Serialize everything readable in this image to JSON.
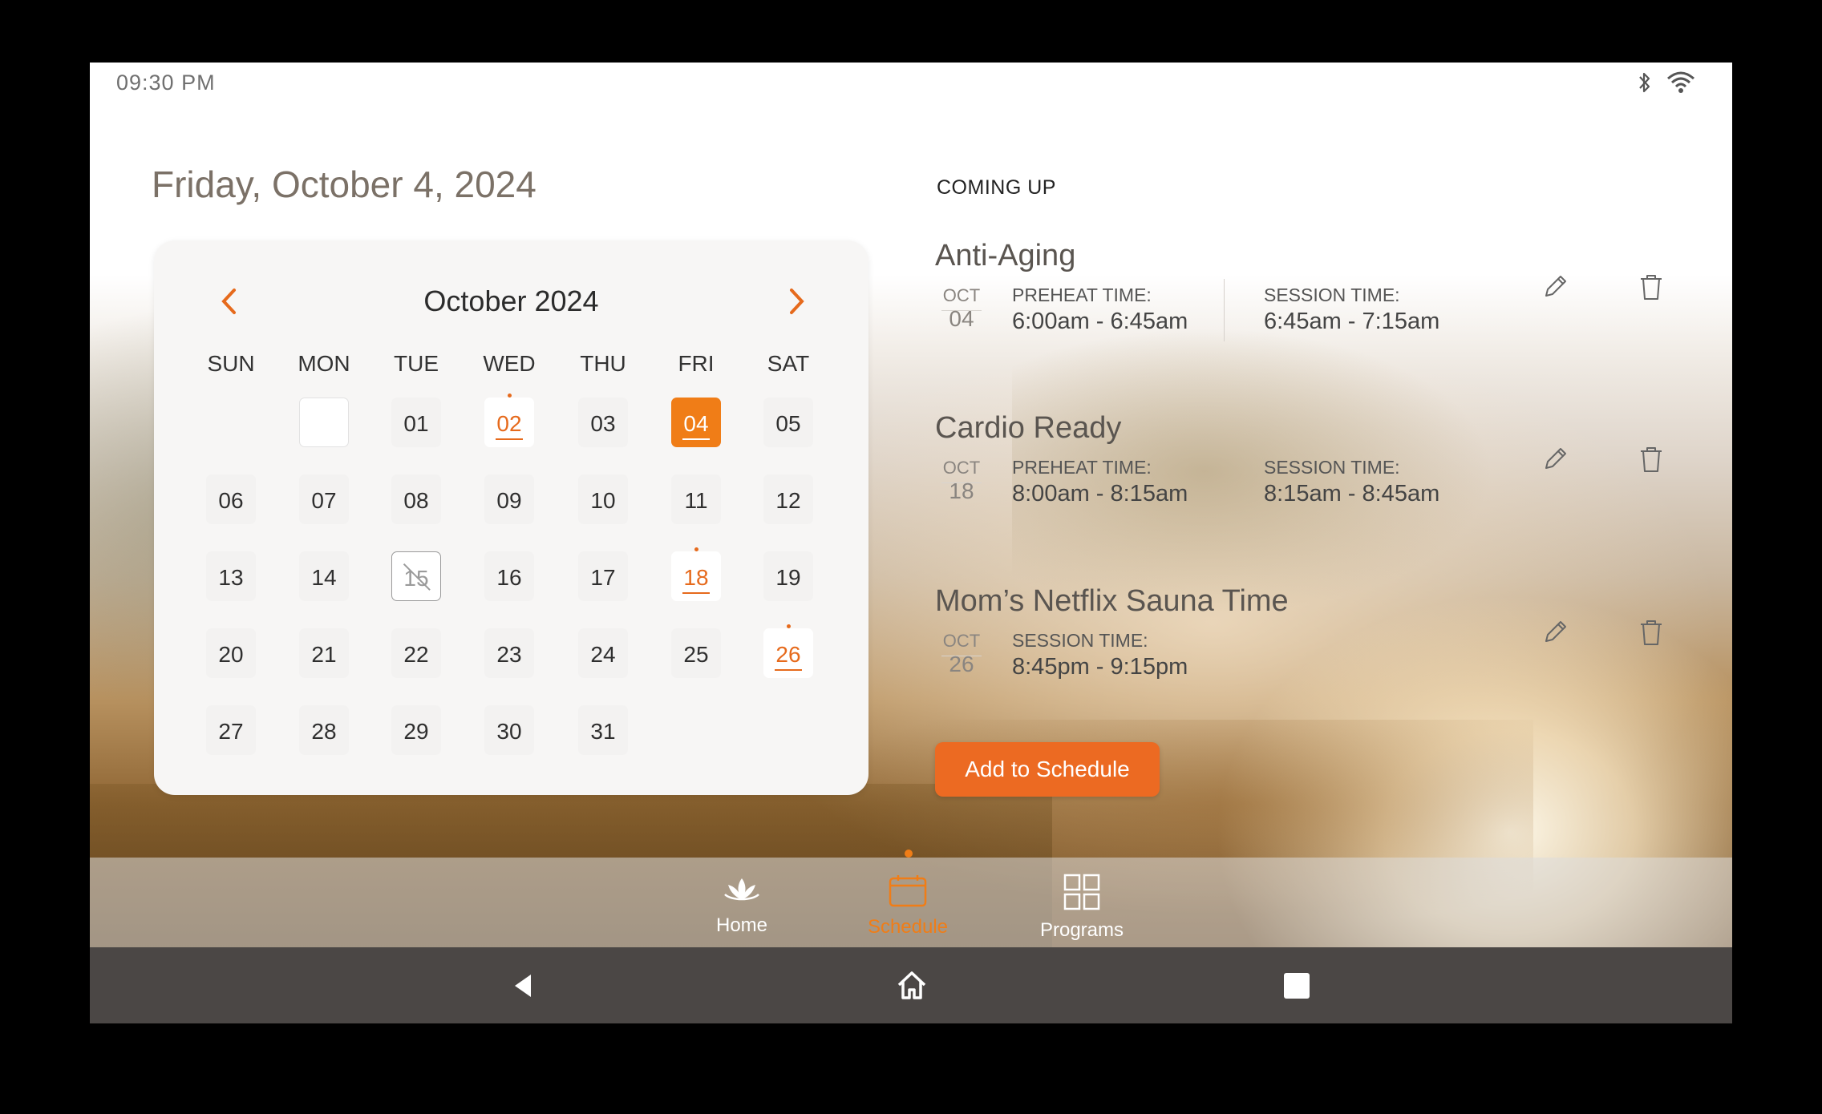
{
  "status": {
    "time": "09:30 PM",
    "icons": [
      "bluetooth-icon",
      "wifi-icon"
    ]
  },
  "header": {
    "date": "Friday, October 4, 2024"
  },
  "calendar": {
    "month_label": "October 2024",
    "weekdays": [
      "SUN",
      "MON",
      "TUE",
      "WED",
      "THU",
      "FRI",
      "SAT"
    ],
    "days": [
      "01",
      "02",
      "03",
      "04",
      "05",
      "06",
      "07",
      "08",
      "09",
      "10",
      "11",
      "12",
      "13",
      "14",
      "15",
      "16",
      "17",
      "18",
      "19",
      "20",
      "21",
      "22",
      "23",
      "24",
      "25",
      "26",
      "27",
      "28",
      "29",
      "30",
      "31"
    ],
    "first_weekday_index": 2,
    "selected_day": "04",
    "event_days": [
      "02",
      "18",
      "26"
    ],
    "disabled_days": [
      "15"
    ]
  },
  "upcoming": {
    "heading": "COMING UP",
    "items": [
      {
        "name": "Anti-Aging",
        "month": "OCT",
        "day": "04",
        "label1": "PREHEAT TIME:",
        "value1": "6:00am - 6:45am",
        "label2": "SESSION TIME:",
        "value2": "6:45am - 7:15am"
      },
      {
        "name": "Cardio Ready",
        "month": "OCT",
        "day": "18",
        "label1": "PREHEAT TIME:",
        "value1": "8:00am - 8:15am",
        "label2": "SESSION TIME:",
        "value2": "8:15am - 8:45am"
      },
      {
        "name": "Mom’s Netflix Sauna Time",
        "month": "OCT",
        "day": "26",
        "label1": "SESSION TIME:",
        "value1": "8:45pm - 9:15pm"
      }
    ],
    "add_label": "Add to Schedule"
  },
  "nav": {
    "items": [
      {
        "label": "Home",
        "icon": "lotus-icon"
      },
      {
        "label": "Schedule",
        "icon": "calendar-icon",
        "active": true
      },
      {
        "label": "Programs",
        "icon": "grid-icon"
      }
    ]
  },
  "system_bar": {
    "buttons": [
      "back-icon",
      "home-icon",
      "recents-icon"
    ]
  },
  "colors": {
    "accent": "#ec6a22",
    "selected": "#f07d17",
    "system_bar": "#4b4745"
  }
}
